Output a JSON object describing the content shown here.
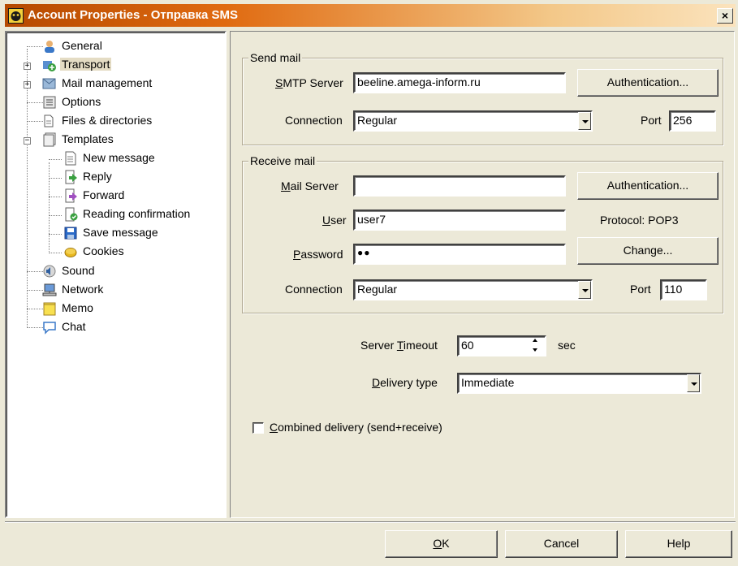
{
  "window": {
    "title": "Account Properties - Отправка SMS",
    "close_label": "×"
  },
  "tree": {
    "items": [
      {
        "label": "General",
        "icon": "general-icon"
      },
      {
        "label": "Transport",
        "icon": "transport-icon",
        "selected": true
      },
      {
        "label": "Mail management",
        "icon": "mail-management-icon"
      },
      {
        "label": "Options",
        "icon": "options-icon"
      },
      {
        "label": "Files & directories",
        "icon": "files-icon"
      },
      {
        "label": "Templates",
        "icon": "templates-icon"
      },
      {
        "label": "New message",
        "icon": "new-message-icon"
      },
      {
        "label": "Reply",
        "icon": "reply-icon"
      },
      {
        "label": "Forward",
        "icon": "forward-icon"
      },
      {
        "label": "Reading confirmation",
        "icon": "reading-confirmation-icon"
      },
      {
        "label": "Save message",
        "icon": "save-message-icon"
      },
      {
        "label": "Cookies",
        "icon": "cookies-icon"
      },
      {
        "label": "Sound",
        "icon": "sound-icon"
      },
      {
        "label": "Network",
        "icon": "network-icon"
      },
      {
        "label": "Memo",
        "icon": "memo-icon"
      },
      {
        "label": "Chat",
        "icon": "chat-icon"
      }
    ],
    "expanders": [
      "+",
      "+",
      "−"
    ]
  },
  "send": {
    "title": "Send mail",
    "smtp_label_first": "S",
    "smtp_label_rest": "MTP Server",
    "smtp_value": "beeline.amega-inform.ru",
    "auth_button": "Authentication...",
    "connection_label": "Connection",
    "connection_value": "Regular",
    "port_label": "Port",
    "port_value": "256"
  },
  "receive": {
    "title": "Receive mail",
    "server_label_first": "M",
    "server_label_rest": "ail Server",
    "server_value": "",
    "auth_button": "Authentication...",
    "user_label_first": "U",
    "user_label_rest": "ser",
    "user_value": "user7",
    "protocol_text": "Protocol:  POP3",
    "password_label_first": "P",
    "password_label_rest": "assword",
    "password_value": "●●",
    "change_button": "Change...",
    "connection_label": "Connection",
    "connection_value": "Regular",
    "port_label": "Port",
    "port_value": "110"
  },
  "timeout": {
    "label_pre": "Server ",
    "label_acc": "T",
    "label_post": "imeout",
    "value": "60",
    "unit": "sec"
  },
  "delivery": {
    "label_acc": "D",
    "label_post": "elivery type",
    "value": "Immediate"
  },
  "combined": {
    "label_acc": "C",
    "label_post": "ombined delivery (send+receive)",
    "checked": false
  },
  "buttons": {
    "ok_acc": "O",
    "ok_rest": "K",
    "cancel": "Cancel",
    "help": "Help"
  }
}
